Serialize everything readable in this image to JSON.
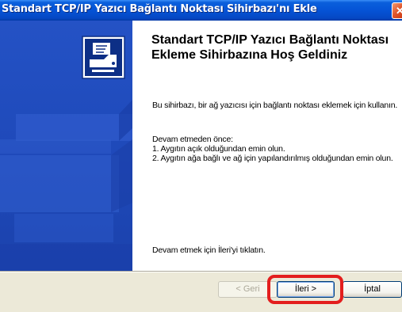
{
  "window": {
    "title": "Standart TCP/IP Yazıcı Bağlantı Noktası Sihirbazı'nı Ekle",
    "close_glyph": "✕"
  },
  "icons": {
    "wizard": "printer-port-wizard-icon",
    "close": "close-icon"
  },
  "content": {
    "heading": "Standart TCP/IP Yazıcı Bağlantı Noktası Ekleme Sihirbazına Hoş Geldiniz",
    "intro": "Bu sihirbazı, bir ağ yazıcısı için bağlantı noktası eklemek için kullanın.",
    "before_title": "Devam etmeden önce:",
    "step1": "1.  Aygıtın açık olduğundan emin olun.",
    "step2": "2.  Aygıtın ağa bağlı ve ağ için yapılandırılmış olduğundan emin olun.",
    "continue_hint": "Devam etmek için İleri'yi tıklatın."
  },
  "buttons": {
    "back": "< Geri",
    "next": "İleri >",
    "cancel": "İptal"
  },
  "colors": {
    "titlebar": "#0553d6",
    "side_panel": "#2452c5",
    "highlight": "#e31e1e"
  }
}
